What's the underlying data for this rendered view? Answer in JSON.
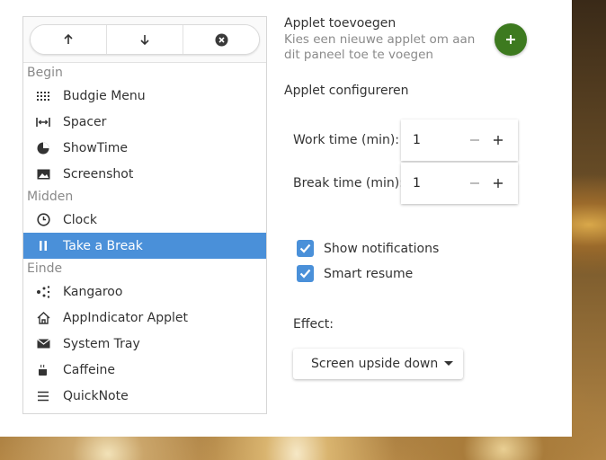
{
  "toolbar": {
    "move_up_icon": "arrow-up-icon",
    "move_down_icon": "arrow-down-icon",
    "remove_icon": "remove-circle-icon"
  },
  "sections": [
    {
      "header": "Begin",
      "items": [
        {
          "label": "Budgie Menu",
          "icon": "app-grid-icon"
        },
        {
          "label": "Spacer",
          "icon": "spacer-icon"
        },
        {
          "label": "ShowTime",
          "icon": "pie-clock-icon"
        },
        {
          "label": "Screenshot",
          "icon": "image-icon"
        }
      ]
    },
    {
      "header": "Midden",
      "items": [
        {
          "label": "Clock",
          "icon": "clock-icon"
        },
        {
          "label": "Take a Break",
          "icon": "pause-icon",
          "selected": true
        }
      ]
    },
    {
      "header": "Einde",
      "items": [
        {
          "label": "Kangaroo",
          "icon": "kangaroo-icon"
        },
        {
          "label": "AppIndicator Applet",
          "icon": "home-icon"
        },
        {
          "label": "System Tray",
          "icon": "envelope-icon"
        },
        {
          "label": "Caffeine",
          "icon": "coffee-cup-icon"
        },
        {
          "label": "QuickNote",
          "icon": "lines-icon"
        }
      ]
    }
  ],
  "add_applet": {
    "title": "Applet toevoegen",
    "description": "Kies een nieuwe applet om aan dit paneel toe te voegen",
    "button_icon": "plus-icon",
    "button_color": "#3d7a1f"
  },
  "configure": {
    "title": "Applet configureren",
    "work_time": {
      "label": "Work time (min):",
      "value": "1"
    },
    "break_time": {
      "label": "Break time (min):",
      "value": "1"
    },
    "show_notifications": {
      "label": "Show notifications",
      "checked": true
    },
    "smart_resume": {
      "label": "Smart resume",
      "checked": true
    },
    "effect": {
      "label": "Effect:",
      "value": "Screen upside down"
    }
  },
  "colors": {
    "accent": "#4a90d9",
    "add_button": "#3d7a1f"
  }
}
